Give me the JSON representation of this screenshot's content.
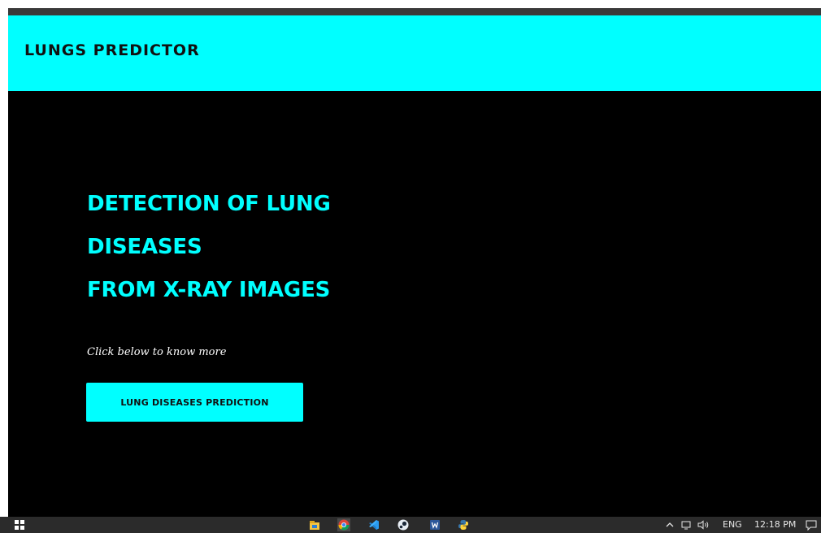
{
  "navbar": {
    "brand": "LUNGS PREDICTOR"
  },
  "hero": {
    "headline_lines": [
      "DETECTION OF LUNG",
      "DISEASES",
      "FROM X-RAY IMAGES"
    ],
    "tagline": "Click below to know more",
    "cta_label": "LUNG DISEASES PREDICTION"
  },
  "taskbar": {
    "apps": [
      "file-explorer-icon",
      "chrome-icon",
      "vscode-icon",
      "steam-icon",
      "word-icon",
      "python-icon"
    ],
    "tray": {
      "language": "ENG",
      "time": "12:18 PM"
    }
  },
  "colors": {
    "accent": "#00ffff",
    "hero_bg": "#000000",
    "taskbar_bg": "#2b2b2b"
  }
}
